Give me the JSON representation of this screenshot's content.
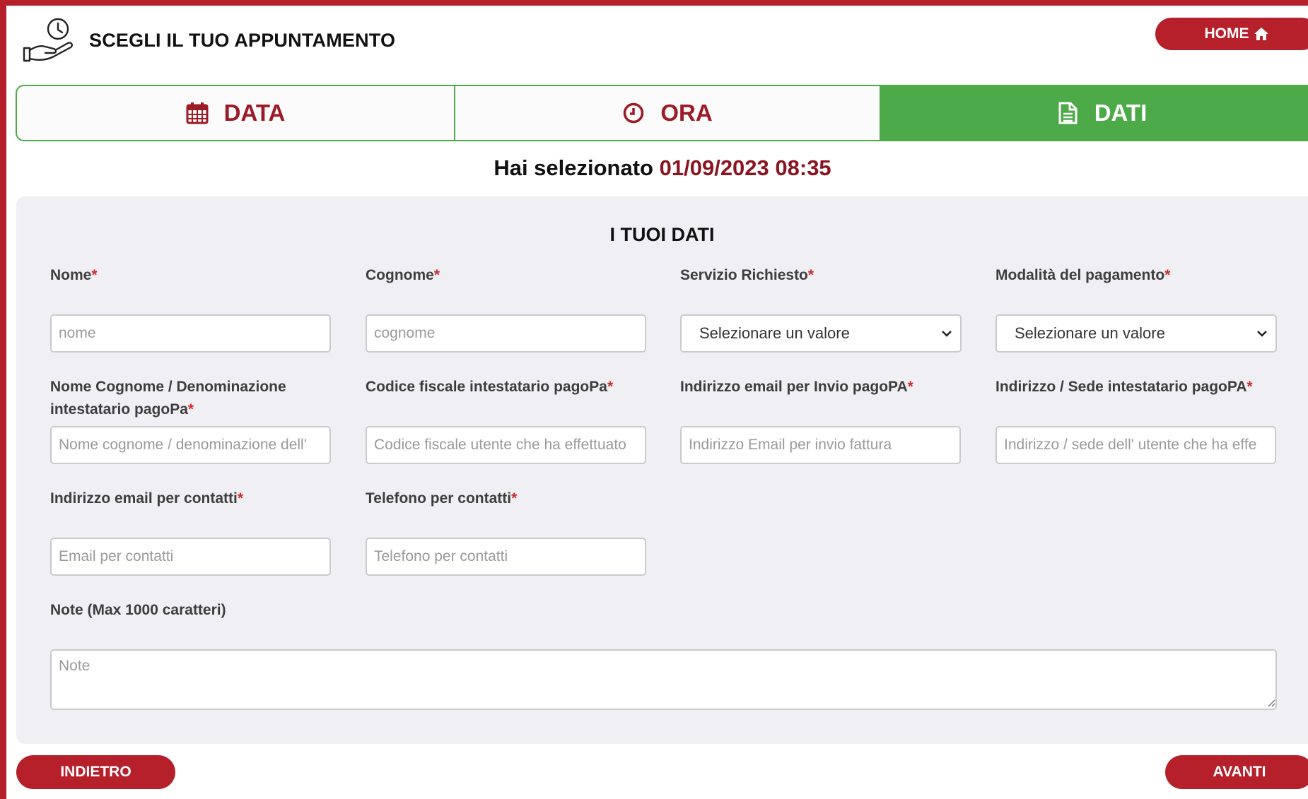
{
  "header": {
    "title": "SCEGLI IL TUO APPUNTAMENTO",
    "icon": "hand-clock-icon",
    "home_label": "HOME",
    "home_icon": "home-icon"
  },
  "tabs": [
    {
      "label": "DATA",
      "icon": "calendar-icon",
      "active": false
    },
    {
      "label": "ORA",
      "icon": "clock-icon",
      "active": false
    },
    {
      "label": "DATI",
      "icon": "document-icon",
      "active": true
    }
  ],
  "selection": {
    "prefix": "Hai selezionato",
    "value": "01/09/2023 08:35"
  },
  "form": {
    "title": "I TUOI DATI",
    "required_mark": "*",
    "fields": {
      "nome": {
        "label": "Nome",
        "placeholder": "nome"
      },
      "cognome": {
        "label": "Cognome",
        "placeholder": "cognome"
      },
      "servizio": {
        "label": "Servizio Richiesto",
        "value": "Selezionare un valore"
      },
      "pagamento": {
        "label": "Modalità del pagamento",
        "value": "Selezionare un valore"
      },
      "intestatario_line1": "Nome Cognome / Denominazione",
      "intestatario_line2": "intestatario pagoPa",
      "intestatario": {
        "placeholder": "Nome cognome / denominazione dell'"
      },
      "codice_fiscale": {
        "label": "Codice fiscale intestatario pagoPa",
        "placeholder": "Codice fiscale utente che ha effettuato"
      },
      "email_pagopa": {
        "label": "Indirizzo email per Invio pagoPA",
        "placeholder": "Indirizzo Email per invio fattura"
      },
      "sede": {
        "label": "Indirizzo / Sede intestatario pagoPA",
        "placeholder": "Indirizzo / sede dell' utente che ha effe"
      },
      "email_contatti": {
        "label": "Indirizzo email per contatti",
        "placeholder": "Email per contatti"
      },
      "telefono": {
        "label": "Telefono per contatti",
        "placeholder": "Telefono per contatti"
      },
      "note": {
        "label": "Note (Max 1000 caratteri)",
        "placeholder": "Note"
      }
    }
  },
  "nav": {
    "back_label": "INDIETRO",
    "next_label": "AVANTI"
  },
  "colors": {
    "brand_red": "#b5202b",
    "accent_green": "#4caa48",
    "dark_red_text": "#8a1520",
    "panel_bg": "#f0f0f4"
  }
}
